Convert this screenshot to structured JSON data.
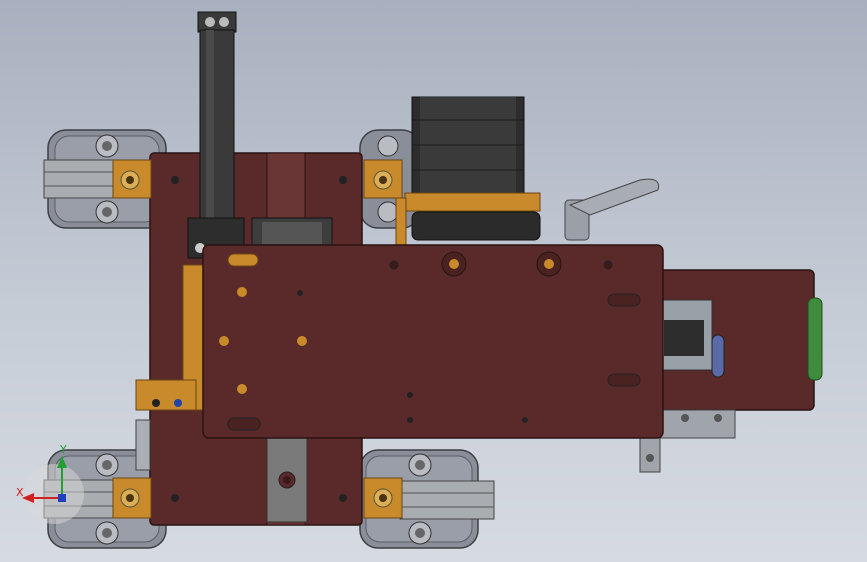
{
  "viewport": {
    "background_top": "#a8b0bf",
    "background_bottom": "#d6dbe2"
  },
  "colors": {
    "plate": "#5a2a2a",
    "plate_edge": "#2b1212",
    "bracket_orange": "#c98a2b",
    "wheel_gray": "#8a8e98",
    "rail_steel": "#a9acb1",
    "motor_black": "#2d2d2d",
    "shaft_black": "#3a3a3a",
    "green_strip": "#3f8c3f"
  },
  "triad": {
    "x_label": "X",
    "y_label": "Y",
    "x_color": "#d02020",
    "y_color": "#20a030",
    "z_color": "#2040c0"
  },
  "parts": {
    "wheels": [
      "wheel-top-left",
      "wheel-top-right",
      "wheel-bottom-left",
      "wheel-bottom-right"
    ],
    "components": [
      "base-plate",
      "upper-cover-plate",
      "stepper-motor",
      "vertical-shaft",
      "clamp-lever",
      "rear-extension-plate",
      "side-bracket"
    ]
  }
}
